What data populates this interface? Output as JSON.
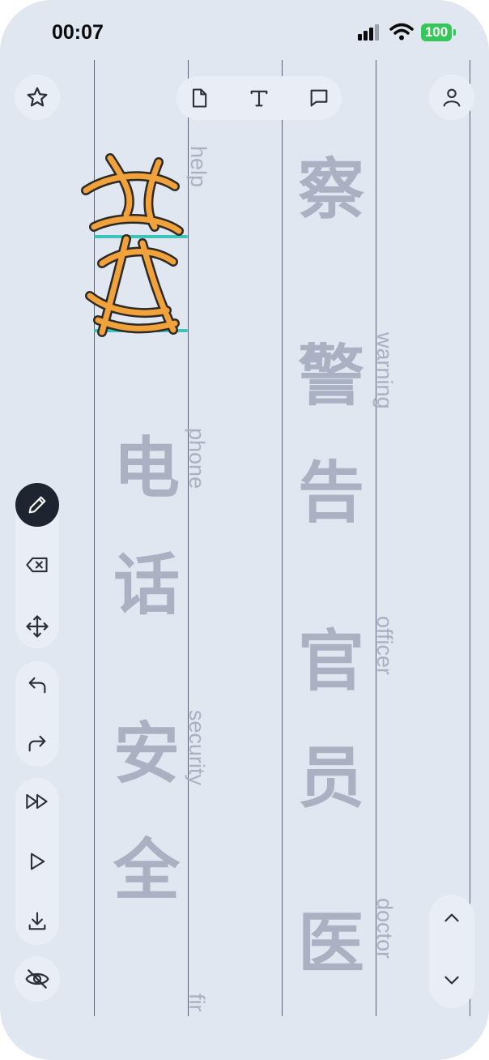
{
  "status_bar": {
    "time": "00:07",
    "battery": "100",
    "battery_color": "#35c759"
  },
  "top_toolbar": {
    "favorite_icon": "star-icon",
    "tools": [
      "document-icon",
      "text-icon",
      "comment-icon"
    ],
    "profile_icon": "person-icon"
  },
  "side_toolbar": {
    "active_color": "#1f2530",
    "tools": [
      "pencil-icon",
      "delete-icon",
      "move-icon",
      "undo-icon",
      "redo-icon",
      "fast-forward-icon",
      "play-icon",
      "download-icon",
      "hide-icon"
    ]
  },
  "scroll_controls": [
    "chevron-up-icon",
    "chevron-down-icon"
  ],
  "practice_sheet": {
    "column_left": [
      {
        "english": "help"
      },
      {
        "chinese": "电",
        "english": "phone"
      },
      {
        "chinese": "话"
      },
      {
        "chinese": "安",
        "english": "security"
      },
      {
        "chinese": "全"
      },
      {
        "english": "fir"
      }
    ],
    "column_right": [
      {
        "chinese": "察"
      },
      {
        "chinese": "警",
        "english": "warning"
      },
      {
        "chinese": "告"
      },
      {
        "chinese": "官",
        "english": "officer"
      },
      {
        "chinese": "员"
      },
      {
        "chinese": "医",
        "english": "doctor"
      }
    ],
    "handwriting_color": "#f2a23a",
    "guide_color": "#3cc4b8"
  }
}
